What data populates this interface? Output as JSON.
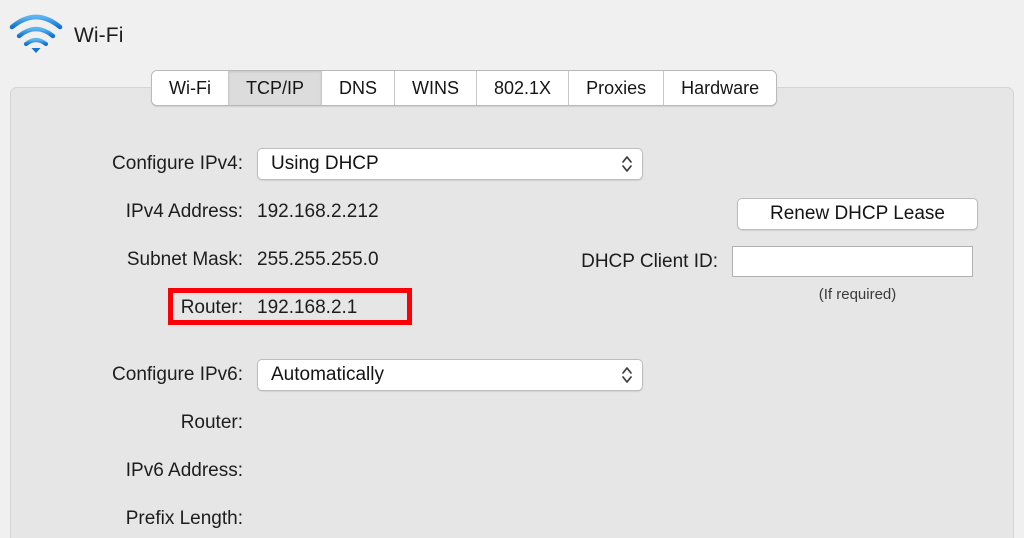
{
  "header": {
    "title": "Wi-Fi",
    "icon": "wifi-icon"
  },
  "tabs": [
    {
      "label": "Wi-Fi",
      "selected": false
    },
    {
      "label": "TCP/IP",
      "selected": true
    },
    {
      "label": "DNS",
      "selected": false
    },
    {
      "label": "WINS",
      "selected": false
    },
    {
      "label": "802.1X",
      "selected": false
    },
    {
      "label": "Proxies",
      "selected": false
    },
    {
      "label": "Hardware",
      "selected": false
    }
  ],
  "ipv4": {
    "configure_label": "Configure IPv4:",
    "configure_value": "Using DHCP",
    "address_label": "IPv4 Address:",
    "address_value": "192.168.2.212",
    "subnet_label": "Subnet Mask:",
    "subnet_value": "255.255.255.0",
    "router_label": "Router:",
    "router_value": "192.168.2.1"
  },
  "dhcp": {
    "renew_button": "Renew DHCP Lease",
    "client_id_label": "DHCP Client ID:",
    "client_id_value": "",
    "client_id_placeholder": "",
    "hint": "(If required)"
  },
  "ipv6": {
    "configure_label": "Configure IPv6:",
    "configure_value": "Automatically",
    "router_label": "Router:",
    "router_value": "",
    "address_label": "IPv6 Address:",
    "address_value": "",
    "prefix_label": "Prefix Length:",
    "prefix_value": ""
  },
  "annotation": {
    "color": "#fb0007",
    "target": "router-row"
  },
  "colors": {
    "page_background": "#f0f0f0",
    "panel_background": "#e6e6e6",
    "accent_blue": "#2f93e0",
    "selected_tab": "#dcdcdc",
    "annotation_red": "#fb0007"
  }
}
